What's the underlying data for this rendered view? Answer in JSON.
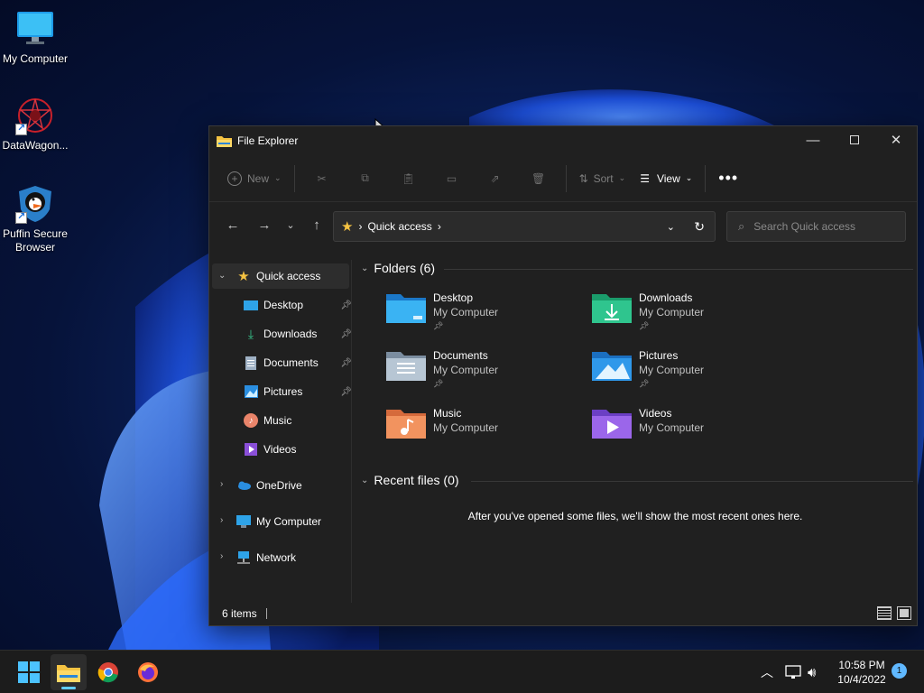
{
  "desktop": {
    "icons": [
      {
        "label": "My Computer"
      },
      {
        "label": "DataWagon..."
      },
      {
        "label": "Puffin Secure Browser"
      }
    ]
  },
  "window": {
    "title": "File Explorer",
    "commands": {
      "new_label": "New",
      "sort_label": "Sort",
      "view_label": "View"
    },
    "address": {
      "location": "Quick access"
    },
    "search": {
      "placeholder": "Search Quick access"
    },
    "sidebar": {
      "quick_access": "Quick access",
      "pinned": [
        {
          "label": "Desktop"
        },
        {
          "label": "Downloads"
        },
        {
          "label": "Documents"
        },
        {
          "label": "Pictures"
        },
        {
          "label": "Music"
        },
        {
          "label": "Videos"
        }
      ],
      "onedrive": "OneDrive",
      "my_computer": "My Computer",
      "network": "Network"
    },
    "folders_header": "Folders (6)",
    "folders": [
      {
        "name": "Desktop",
        "location": "My Computer"
      },
      {
        "name": "Downloads",
        "location": "My Computer"
      },
      {
        "name": "Documents",
        "location": "My Computer"
      },
      {
        "name": "Pictures",
        "location": "My Computer"
      },
      {
        "name": "Music",
        "location": "My Computer"
      },
      {
        "name": "Videos",
        "location": "My Computer"
      }
    ],
    "recent_header": "Recent files (0)",
    "recent_empty": "After you've opened some files, we'll show the most recent ones here.",
    "status": "6 items"
  },
  "taskbar": {
    "time": "10:58 PM",
    "date": "10/4/2022",
    "notification_count": "1"
  },
  "colors": {
    "accent": "#60cdff",
    "window_bg": "#202020",
    "taskbar_bg": "#1c1c1c"
  }
}
